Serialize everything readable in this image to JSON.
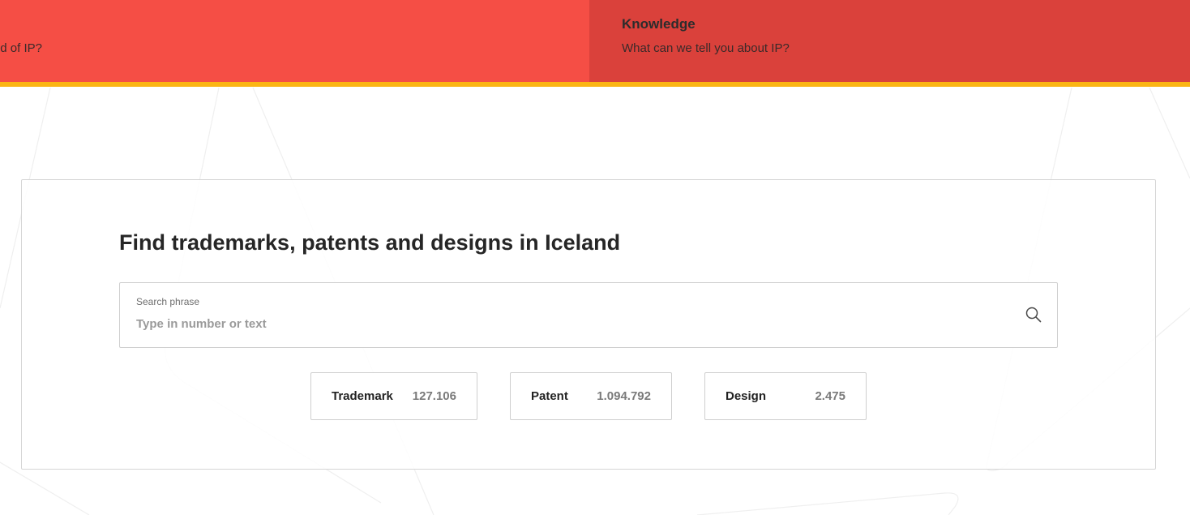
{
  "top_nav": {
    "left_panel": {
      "subtitle": "d of IP?"
    },
    "right_panel": {
      "title": "Knowledge",
      "subtitle": "What can we tell you about IP?"
    }
  },
  "search_section": {
    "title": "Find trademarks, patents and designs in Iceland",
    "search": {
      "label": "Search phrase",
      "placeholder": "Type in number or text",
      "value": ""
    },
    "categories": [
      {
        "label": "Trademark",
        "count": "127.106"
      },
      {
        "label": "Patent",
        "count": "1.094.792"
      },
      {
        "label": "Design",
        "count": "2.475"
      }
    ]
  },
  "colors": {
    "nav_left": "#f54e45",
    "nav_right": "#da413b",
    "accent_bar": "#fbb514",
    "title_text": "#262626",
    "count_text": "#7a7a7a"
  },
  "icons": {
    "search": "search-icon"
  }
}
